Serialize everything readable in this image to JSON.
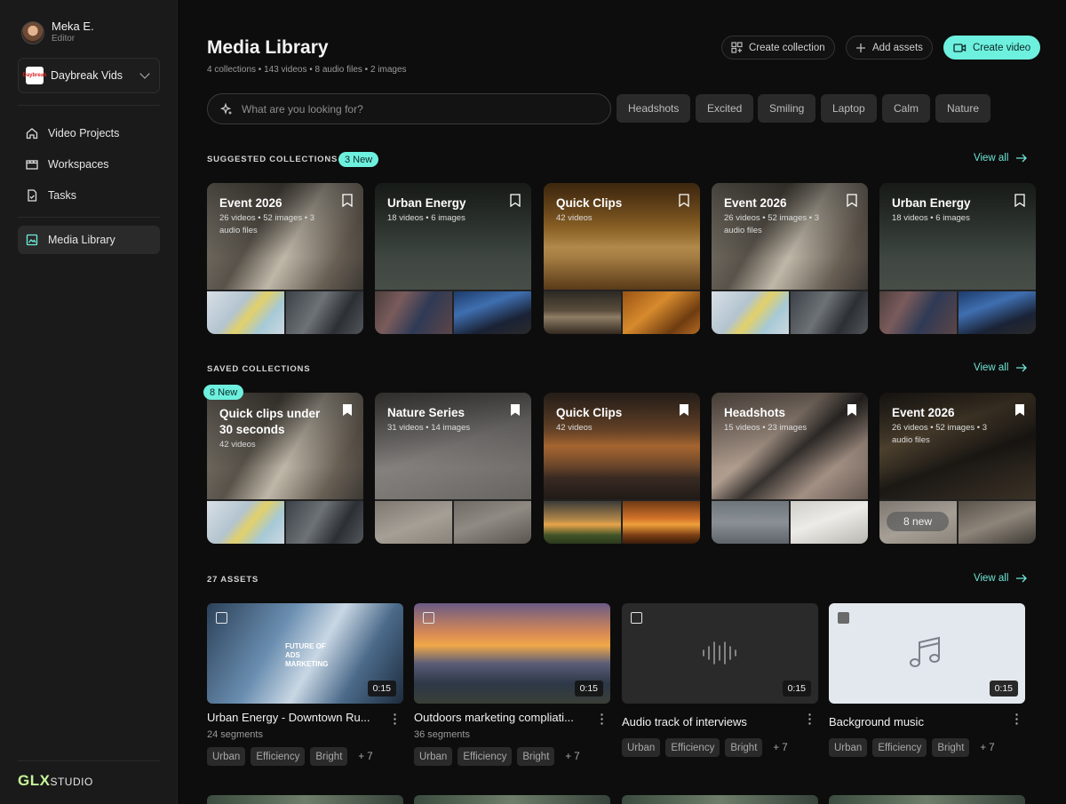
{
  "user": {
    "name": "Meka E.",
    "role": "Editor"
  },
  "workspace": {
    "name": "Daybreak Vids",
    "logo_text": "Daybreak"
  },
  "nav": [
    {
      "label": "Video Projects",
      "icon": "home-icon"
    },
    {
      "label": "Workspaces",
      "icon": "clapper-icon"
    },
    {
      "label": "Tasks",
      "icon": "task-icon"
    },
    {
      "label": "Media Library",
      "icon": "image-icon",
      "active": true
    }
  ],
  "brand": {
    "mark": "GLX",
    "text": "STUDIO"
  },
  "page": {
    "title": "Media Library",
    "summary": "4 collections • 143 videos • 8 audio files • 2 images"
  },
  "actions": {
    "create_collection": "Create collection",
    "add_assets": "Add assets",
    "create_video": "Create video"
  },
  "search": {
    "placeholder": "What are you looking for?"
  },
  "filters": [
    "Headshots",
    "Excited",
    "Smiling",
    "Laptop",
    "Calm",
    "Nature"
  ],
  "suggested": {
    "title": "SUGGESTED COLLECTIONS",
    "badge": "3 New",
    "view_all": "View all",
    "cards": [
      {
        "title": "Event 2026",
        "sub": "26 videos • 52 images • 3 audio files"
      },
      {
        "title": "Urban Energy",
        "sub": "18 videos • 6 images"
      },
      {
        "title": "Quick Clips",
        "sub": "42 videos"
      },
      {
        "title": "Event 2026",
        "sub": "26 videos • 52 images • 3 audio files"
      },
      {
        "title": "Urban Energy",
        "sub": "18 videos • 6 images"
      }
    ]
  },
  "saved": {
    "title": "SAVED COLLECTIONS",
    "badge": "8 New",
    "view_all": "View all",
    "cards": [
      {
        "title": "Quick clips under 30 seconds",
        "sub": "42 videos"
      },
      {
        "title": "Nature Series",
        "sub": "31 videos • 14 images"
      },
      {
        "title": "Quick Clips",
        "sub": "42 videos"
      },
      {
        "title": "Headshots",
        "sub": "15 videos • 23 images"
      },
      {
        "title": "Event 2026",
        "sub": "26 videos • 52 images • 3 audio files",
        "new_overlay": "8 new"
      }
    ]
  },
  "assets": {
    "title": "27 ASSETS",
    "view_all": "View all",
    "items": [
      {
        "title": "Urban Energy - Downtown Ru...",
        "sub": "24 segments",
        "duration": "0:15",
        "thumb_text": "FUTURE OF ADS MARKETING",
        "tags": [
          "Urban",
          "Efficiency",
          "Bright"
        ],
        "more": "+ 7"
      },
      {
        "title": "Outdoors marketing compliati...",
        "sub": "36 segments",
        "duration": "0:15",
        "tags": [
          "Urban",
          "Efficiency",
          "Bright"
        ],
        "more": "+ 7"
      },
      {
        "title": "Audio track of interviews",
        "sub": "",
        "duration": "0:15",
        "tags": [
          "Urban",
          "Efficiency",
          "Bright"
        ],
        "more": "+ 7"
      },
      {
        "title": "Background music",
        "sub": "",
        "duration": "0:15",
        "tags": [
          "Urban",
          "Efficiency",
          "Bright"
        ],
        "more": "+ 7"
      }
    ]
  },
  "colors": {
    "accent": "#6ef0de",
    "sidebar": "#1a1a1a",
    "background": "#0d0d0d"
  }
}
